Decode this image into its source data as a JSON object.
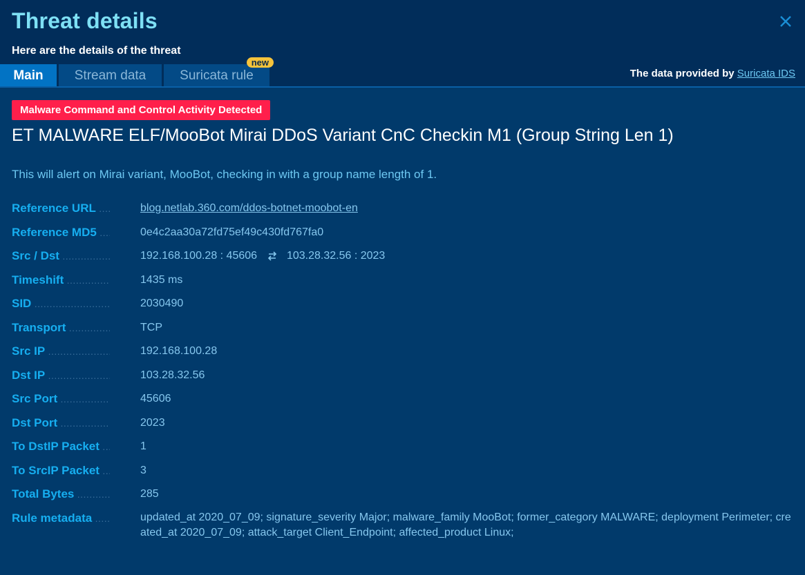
{
  "header": {
    "title": "Threat details",
    "subtitle": "Here are the details of the threat",
    "close_icon": "close-icon",
    "provided_by_label": "The data provided by",
    "provided_by_link": "Suricata IDS"
  },
  "tabs": [
    {
      "label": "Main",
      "active": true
    },
    {
      "label": "Stream data",
      "active": false
    },
    {
      "label": "Suricata rule",
      "active": false,
      "badge": "new"
    }
  ],
  "alert": {
    "category": "Malware Command and Control Activity Detected",
    "category_color": "#ff1f4b",
    "rule_name": "ET MALWARE ELF/MooBot Mirai DDoS Variant CnC Checkin M1 (Group String Len 1)",
    "description": "This will alert on Mirai variant, MooBot, checking in with a group name length of 1."
  },
  "fields": {
    "reference_url": {
      "label": "Reference URL",
      "value": "blog.netlab.360.com/ddos-botnet-moobot-en"
    },
    "reference_md5": {
      "label": "Reference MD5",
      "value": "0e4c2aa30a72fd75ef49c430fd767fa0"
    },
    "src_dst": {
      "label": "Src / Dst",
      "src": "192.168.100.28 : 45606",
      "icon": "swap-arrows-icon",
      "dst": "103.28.32.56 : 2023"
    },
    "timeshift": {
      "label": "Timeshift",
      "value": "1435 ms"
    },
    "sid": {
      "label": "SID",
      "value": "2030490"
    },
    "transport": {
      "label": "Transport",
      "value": "TCP"
    },
    "src_ip": {
      "label": "Src IP",
      "value": "192.168.100.28"
    },
    "dst_ip": {
      "label": "Dst IP",
      "value": "103.28.32.56"
    },
    "src_port": {
      "label": "Src Port",
      "value": "45606"
    },
    "dst_port": {
      "label": "Dst Port",
      "value": "2023"
    },
    "to_dst_packets": {
      "label": "To DstIP Packet",
      "value": "1"
    },
    "to_src_packets": {
      "label": "To SrcIP Packet",
      "value": "3"
    },
    "total_bytes": {
      "label": "Total Bytes",
      "value": "285"
    },
    "rule_metadata": {
      "label": "Rule metadata",
      "value": "updated_at 2020_07_09; signature_severity Major; malware_family MooBot; former_category MALWARE; deployment Perimeter; created_at 2020_07_09; attack_target Client_Endpoint; affected_product Linux;"
    }
  }
}
